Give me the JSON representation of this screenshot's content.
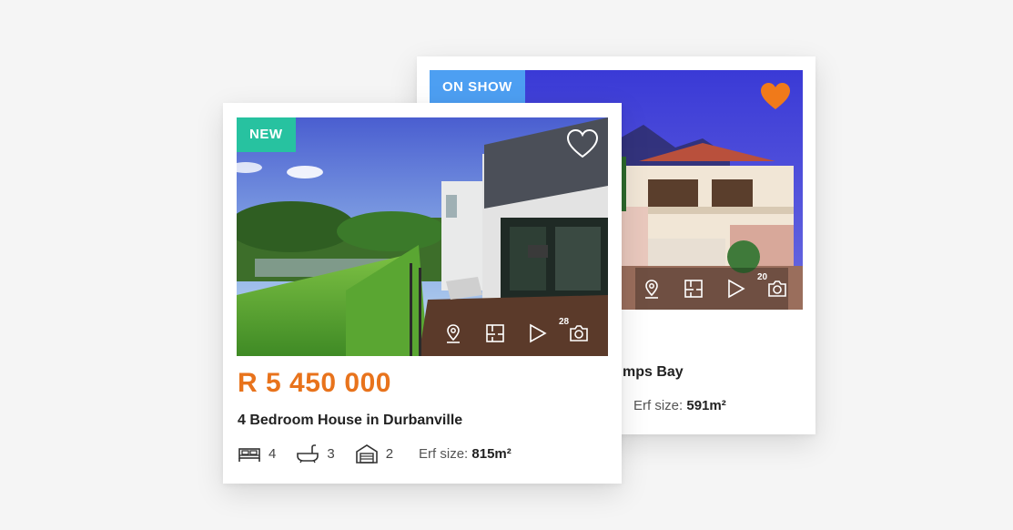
{
  "back_card": {
    "badge": "ON SHOW",
    "photo_count": "20",
    "title_visible": "mps Bay",
    "erf_label": "Erf size:",
    "erf_value": "591m²",
    "favourite_state": "filled",
    "favourite_color": "#f07a1a"
  },
  "front_card": {
    "badge": "NEW",
    "photo_count": "28",
    "price": "R 5 450 000",
    "title": "4 Bedroom House in Durbanville",
    "bedrooms": "4",
    "bathrooms": "3",
    "garages": "2",
    "erf_label": "Erf size:",
    "erf_value": "815m²",
    "favourite_state": "outline"
  },
  "icons": [
    "heart-icon",
    "map-pin-icon",
    "floorplan-icon",
    "play-icon",
    "camera-icon",
    "bed-icon",
    "bath-icon",
    "garage-icon"
  ],
  "colors": {
    "new_badge": "#27c2a0",
    "on_show_badge": "#4d9ff2",
    "price": "#e8731c"
  }
}
